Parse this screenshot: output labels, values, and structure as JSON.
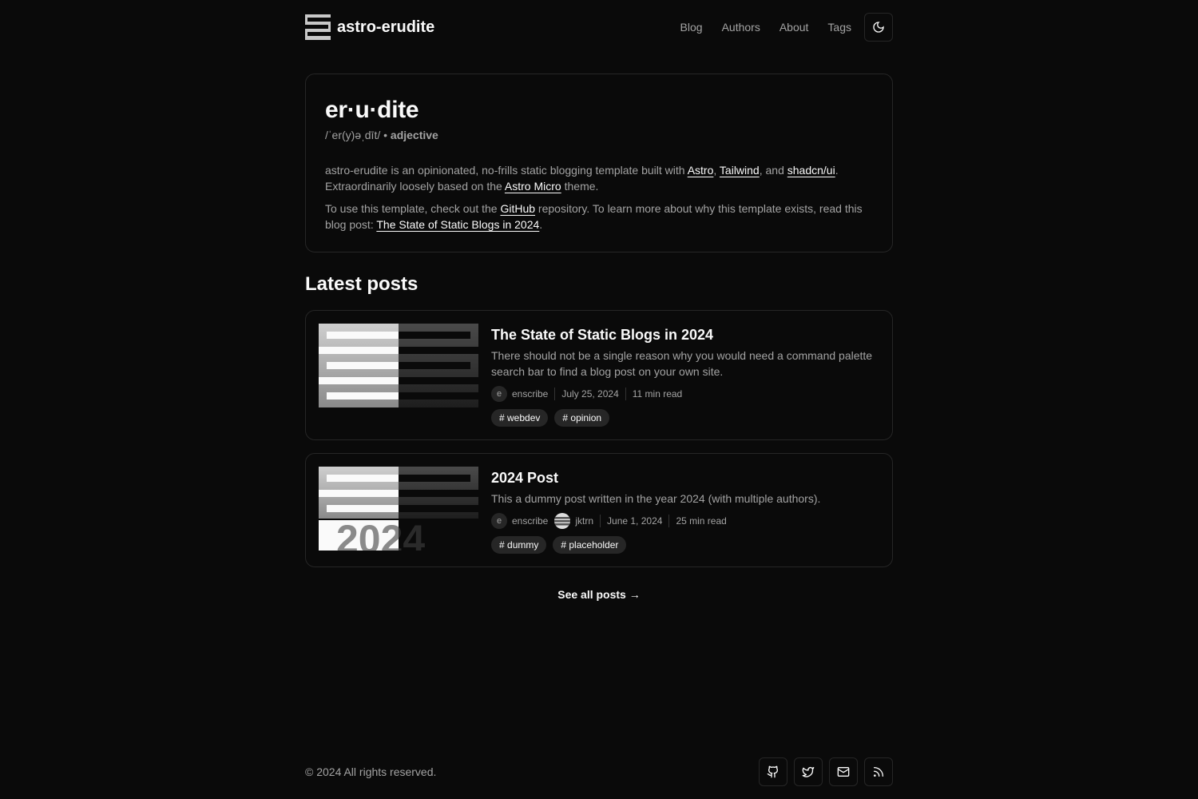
{
  "header": {
    "brand": "astro-erudite",
    "nav": [
      "Blog",
      "Authors",
      "About",
      "Tags"
    ],
    "theme_icon": "moon-icon"
  },
  "hero": {
    "word": "er·u·dite",
    "pronunciation": "/ˈer(y)əˌdīt/ •",
    "pos": "adjective",
    "p1": {
      "t1": "astro-erudite is an opinionated, no-frills static blogging template built with ",
      "l1": "Astro",
      "t2": ", ",
      "l2": "Tailwind",
      "t3": ", and ",
      "l3": "shadcn/ui",
      "t4": ". Extraordinarily loosely based on the ",
      "l4": "Astro Micro",
      "t5": " theme."
    },
    "p2": {
      "t1": "To use this template, check out the ",
      "l1": "GitHub",
      "t2": " repository. To learn more about why this template exists, read this blog post: ",
      "l2": "The State of Static Blogs in 2024",
      "t3": "."
    }
  },
  "latest": {
    "heading": "Latest posts",
    "posts": [
      {
        "title": "The State of Static Blogs in 2024",
        "desc": "There should not be a single reason why you would need a command palette search bar to find a blog post on your own site.",
        "authors": [
          {
            "initial": "e",
            "name": "enscribe"
          }
        ],
        "date": "July 25, 2024",
        "read": "11 min read",
        "tags": [
          "webdev",
          "opinion"
        ]
      },
      {
        "title": "2024 Post",
        "desc": "This a dummy post written in the year 2024 (with multiple authors).",
        "authors": [
          {
            "initial": "e",
            "name": "enscribe"
          },
          {
            "initial": "",
            "name": "jktrn"
          }
        ],
        "date": "June 1, 2024",
        "read": "25 min read",
        "tags": [
          "dummy",
          "placeholder"
        ],
        "thumb_text": "2024"
      }
    ],
    "see_all": "See all posts →"
  },
  "footer": {
    "copyright": "© 2024 All rights reserved.",
    "socials": [
      "github-icon",
      "twitter-icon",
      "mail-icon",
      "rss-icon"
    ]
  }
}
